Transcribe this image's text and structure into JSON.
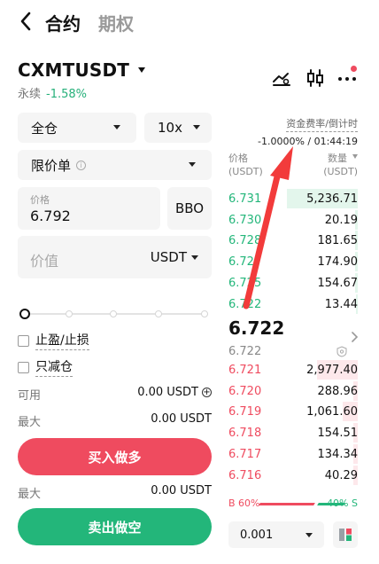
{
  "nav": {
    "tabs": [
      {
        "label": "合约"
      },
      {
        "label": "期权"
      }
    ]
  },
  "header": {
    "symbol": "CXMTUSDT",
    "type": "永续",
    "change": "-1.58%",
    "icons": [
      "chart-settings-icon",
      "candlestick-icon",
      "more-icon"
    ]
  },
  "form": {
    "margin_mode": "全仓",
    "leverage": "10x",
    "order_type": "限价单",
    "price_label": "价格",
    "price_value": "6.792",
    "bbo_label": "BBO",
    "value_placeholder": "价值",
    "value_unit": "USDT",
    "tpsl_label": "止盈/止损",
    "reduce_only_label": "只减仓",
    "available_label": "可用",
    "available_value": "0.00 USDT",
    "max_buy_label": "最大",
    "max_buy_value": "0.00 USDT",
    "buy_label": "买入做多",
    "max_sell_label": "最大",
    "max_sell_value": "0.00 USDT",
    "sell_label": "卖出做空"
  },
  "funding": {
    "title": "资金费率/倒计时",
    "value": "-1.0000% / 01:44:19"
  },
  "orderbook": {
    "price_header": "价格",
    "qty_header": "数量",
    "unit": "(USDT)",
    "bids": [
      {
        "price": "6.731",
        "qty": "5,236.71",
        "depth": 1.0
      },
      {
        "price": "6.730",
        "qty": "20.19",
        "depth": 0.04
      },
      {
        "price": "6.728",
        "qty": "181.65",
        "depth": 0.04
      },
      {
        "price": "6.727",
        "qty": "174.90",
        "depth": 0.04
      },
      {
        "price": "6.725",
        "qty": "154.67",
        "depth": 0.04
      },
      {
        "price": "6.722",
        "qty": "13.44",
        "depth": 0.03
      }
    ],
    "last_price": "6.722",
    "mark_price": "6.722",
    "asks": [
      {
        "price": "6.721",
        "qty": "2,977.40",
        "depth": 0.57
      },
      {
        "price": "6.720",
        "qty": "288.96",
        "depth": 0.06
      },
      {
        "price": "6.719",
        "qty": "1,061.60",
        "depth": 0.21
      },
      {
        "price": "6.718",
        "qty": "154.51",
        "depth": 0.06
      },
      {
        "price": "6.717",
        "qty": "134.34",
        "depth": 0.06
      },
      {
        "price": "6.716",
        "qty": "40.29",
        "depth": 0.06
      }
    ],
    "buy_ratio": "B 60%",
    "sell_ratio": "40% S",
    "depth_step": "0.001"
  },
  "colors": {
    "buy": "#23b67a",
    "sell": "#ef4b5f",
    "annotation": "#f23b3b"
  }
}
